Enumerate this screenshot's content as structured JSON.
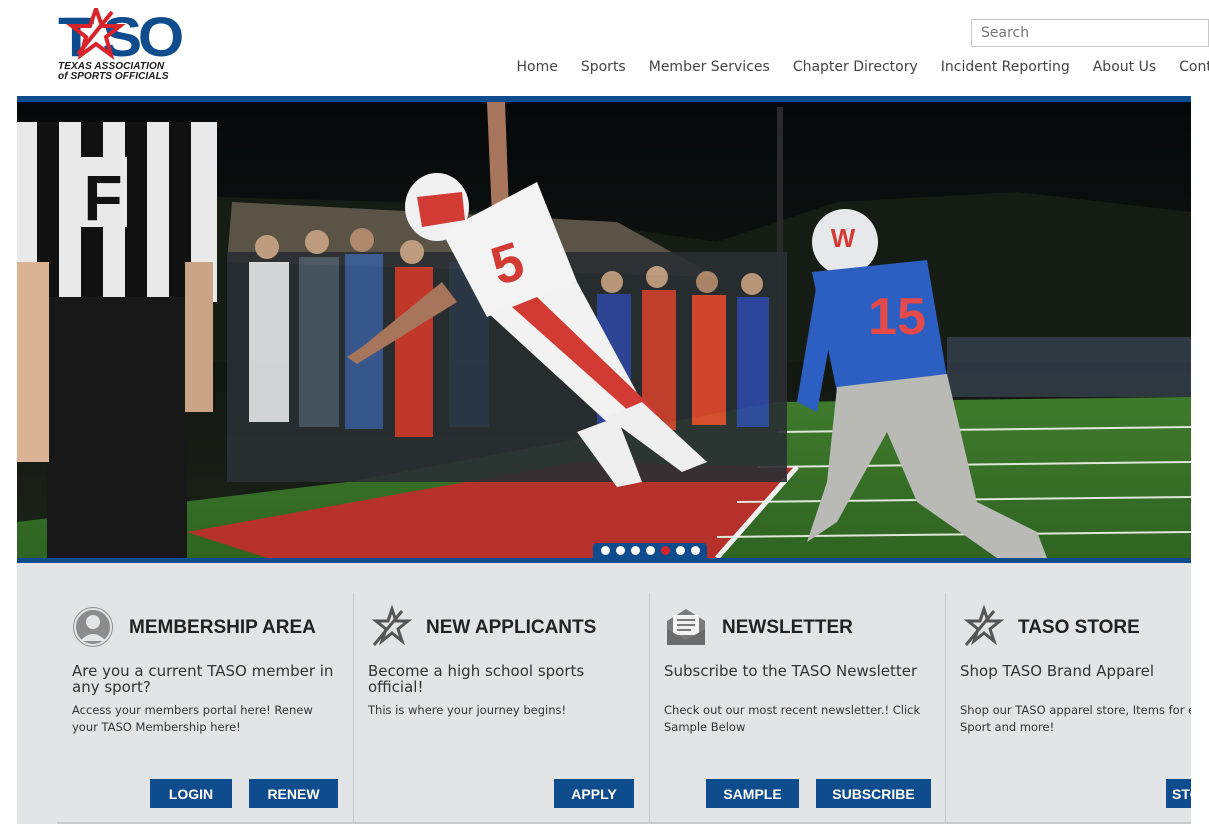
{
  "brand": {
    "logo_text": "T★SO",
    "logo_line1": "TEXAS ASSOCIATION",
    "logo_line2": "of SPORTS OFFICIALS",
    "color_blue": "#0f4c8e",
    "color_red": "#d8232a"
  },
  "search": {
    "placeholder": "Search"
  },
  "nav": [
    "Home",
    "Sports",
    "Member Services",
    "Chapter Directory",
    "Incident Reporting",
    "About Us",
    "Contact"
  ],
  "hero": {
    "slide_count": 7,
    "active_slide": 5,
    "referee_letter": "F",
    "player1_number": "5",
    "player2_number": "15",
    "player2_helmet": "W"
  },
  "features": [
    {
      "icon": "person-icon",
      "title": "MEMBERSHIP AREA",
      "subtitle": "Are you a current TASO member in any sport?",
      "description": "Access your members portal here! Renew your TASO Membership here!",
      "buttons": [
        "LOGIN",
        "RENEW"
      ]
    },
    {
      "icon": "taso-star-icon",
      "title": "NEW APPLICANTS",
      "subtitle": "Become a high school sports official!",
      "description": "This is where your journey begins!",
      "buttons": [
        "APPLY"
      ]
    },
    {
      "icon": "newsletter-icon",
      "title": "NEWSLETTER",
      "subtitle": "Subscribe to the TASO Newsletter",
      "description": "Check out our most recent newsletter.! Click Sample Below",
      "buttons": [
        "SAMPLE",
        "SUBSCRIBE"
      ]
    },
    {
      "icon": "taso-star-icon",
      "title": "TASO STORE",
      "subtitle": "Shop TASO Brand Apparel",
      "description": "Shop our TASO apparel store, Items for every Sport and more!",
      "buttons": [
        "STORE"
      ]
    }
  ]
}
